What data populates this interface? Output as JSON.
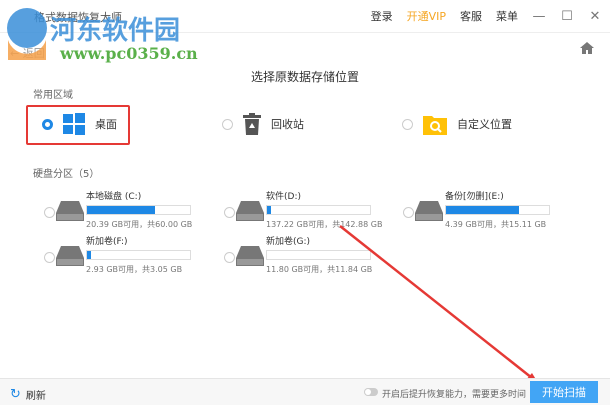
{
  "window": {
    "title": "格式数据恢复大师",
    "login": "登录",
    "vip": "开通VIP",
    "service": "客服",
    "menu": "菜单"
  },
  "nav": {
    "back": "返回"
  },
  "heading": "选择原数据存储位置",
  "common": {
    "label": "常用区域",
    "items": [
      {
        "label": "桌面",
        "selected": true
      },
      {
        "label": "回收站",
        "selected": false
      },
      {
        "label": "自定义位置",
        "selected": false
      }
    ]
  },
  "disks": {
    "label": "硬盘分区（5）",
    "items": [
      {
        "name": "本地磁盘 (C:)",
        "info": "20.39 GB可用，共60.00 GB",
        "used_percent": 66
      },
      {
        "name": "软件(D:)",
        "info": "137.22 GB可用，共142.88 GB",
        "used_percent": 4
      },
      {
        "name": "备份[勿删](E:)",
        "info": "4.39 GB可用，共15.11 GB",
        "used_percent": 71
      },
      {
        "name": "新加卷(F:)",
        "info": "2.93 GB可用，共3.05 GB",
        "used_percent": 4
      },
      {
        "name": "新加卷(G:)",
        "info": "11.80 GB可用，共11.84 GB",
        "used_percent": 0
      }
    ]
  },
  "footer": {
    "refresh": "刷新",
    "tip": "开启后提升恢复能力，需要更多时间",
    "scan": "开始扫描"
  },
  "watermark": {
    "name": "河东软件园",
    "url": "www.pc0359.cn"
  }
}
